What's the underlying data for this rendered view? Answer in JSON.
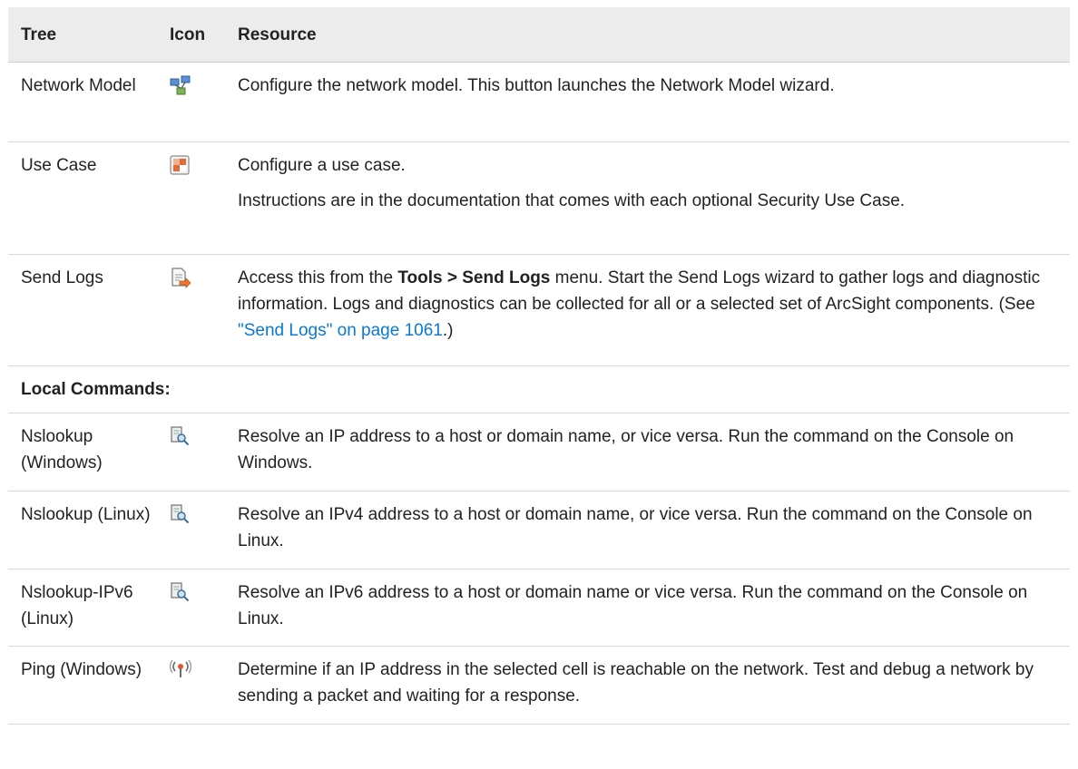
{
  "header": {
    "tree": "Tree",
    "icon": "Icon",
    "resource": "Resource"
  },
  "rows": [
    {
      "tree": "Network Model",
      "icon": "network-model-icon",
      "resource": [
        "Configure the network model. This button launches the Network Model wizard."
      ]
    },
    {
      "tree": "Use Case",
      "icon": "use-case-icon",
      "resource": [
        "Configure a use case.",
        "Instructions are in the documentation that comes with each optional Security Use Case."
      ]
    },
    {
      "tree": "Send Logs",
      "icon": "send-logs-icon",
      "resource_parts": {
        "p1": "Access this from the ",
        "bold": "Tools > Send Logs",
        "p2": " menu. Start the Send Logs wizard to gather logs and diagnostic information. Logs and diagnostics can be collected for all or a selected set of ArcSight components. (See ",
        "link": "\"Send Logs\" on page 1061",
        "p3": ".)"
      }
    }
  ],
  "section_label": "Local Commands:",
  "commands": [
    {
      "tree": "Nslookup (Windows)",
      "icon": "nslookup-icon",
      "resource": "Resolve an IP address to a host or domain name, or vice versa. Run the command on the Console on Windows."
    },
    {
      "tree": "Nslookup (Linux)",
      "icon": "nslookup-icon",
      "resource": "Resolve an IPv4 address to a host or domain name, or vice versa. Run the command on the Console on Linux."
    },
    {
      "tree": "Nslookup-IPv6 (Linux)",
      "icon": "nslookup-icon",
      "resource": "Resolve an IPv6 address to a host or domain name or vice versa. Run the command on the Console on Linux."
    },
    {
      "tree": "Ping (Windows)",
      "icon": "ping-icon",
      "resource": "Determine if an IP address in the selected cell is reachable on the network. Test and debug a network by sending a packet and waiting for a response."
    }
  ]
}
